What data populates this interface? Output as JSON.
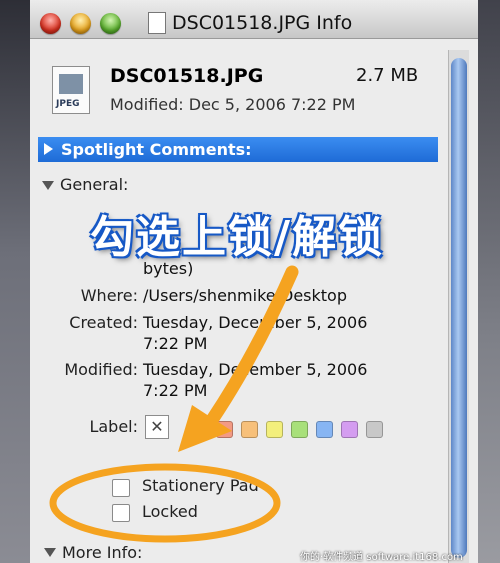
{
  "window": {
    "title": "DSC01518.JPG Info"
  },
  "file": {
    "name": "DSC01518.JPG",
    "size": "2.7 MB",
    "modified": "Modified: Dec 5, 2006 7:22 PM",
    "icon_label": "JPEG"
  },
  "spotlight": {
    "label": "Spotlight Comments:"
  },
  "general": {
    "label": "General:",
    "partial_bytes": "bytes)",
    "where_label": "Where:",
    "where_value": "/Users/shenmike/Desktop",
    "created_label": "Created:",
    "created_line1": "Tuesday, December 5, 2006",
    "created_line2": "7:22 PM",
    "modified_label": "Modified:",
    "modified_line1": "Tuesday, December 5, 2006",
    "modified_line2": "7:22 PM",
    "label_label": "Label:",
    "label_clear": "✕",
    "swatch_colors": [
      "#f29a84",
      "#f7c07a",
      "#f3ef7c",
      "#a8e07a",
      "#87b5f3",
      "#d49df0",
      "#c8c8c8"
    ],
    "stationery_label": "Stationery Pad",
    "locked_label": "Locked"
  },
  "more_info": {
    "label": "More Info:"
  },
  "annotation": {
    "text": "勾选上锁/解锁",
    "color": "#f5a320"
  },
  "watermark": {
    "text": "你的·软件频道 software.it168.com"
  }
}
